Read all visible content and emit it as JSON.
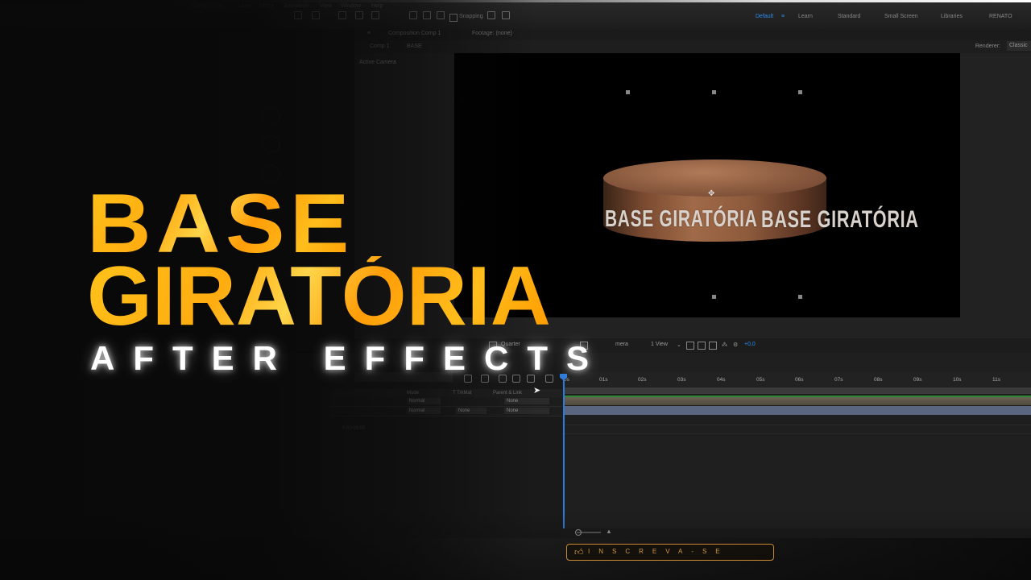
{
  "menu": {
    "items": [
      "Composition",
      "Layer",
      "Effect",
      "Animation",
      "View",
      "Window",
      "Help"
    ]
  },
  "toolbar": {
    "snapping_label": "Snapping"
  },
  "workspaces": {
    "active": "Default",
    "items": [
      "Learn",
      "Standard",
      "Small Screen",
      "Libraries",
      "RENATO"
    ]
  },
  "panels": {
    "composition_tab": "Composition Comp 1",
    "footage_tab": "Footage: (none)",
    "comp_subtabs": [
      "Comp 1",
      "BASE"
    ],
    "renderer_label": "Renderer:",
    "renderer_value": "Classic"
  },
  "viewer": {
    "camera_label": "Active Camera",
    "band_text": [
      "BASE GIRATÓRIA",
      "BASE GIRATÓRIA"
    ],
    "quality": "Quarter",
    "camera_select": "mera",
    "view_select": "1 View",
    "exposure": "+0,0"
  },
  "timeline": {
    "ticks": [
      "0s",
      "01s",
      "02s",
      "03s",
      "04s",
      "05s",
      "06s",
      "07s",
      "08s",
      "09s",
      "10s",
      "11s"
    ],
    "columns": [
      "Mode",
      "T TrkMat",
      "Parent & Link"
    ],
    "layers": [
      {
        "mode": "Normal",
        "trkmat": "",
        "parent": "None"
      },
      {
        "mode": "Normal",
        "trkmat": "None",
        "parent": "None"
      }
    ],
    "zoom_readout": "0:00:00:00"
  },
  "headline": {
    "line1": "BASE",
    "line2": "GIRATÓRIA",
    "subtitle": "AFTER EFFECTS"
  },
  "subscribe": {
    "icon": "thumbs-up-icon",
    "label": "INSCREVA-SE"
  },
  "colors": {
    "accent_blue": "#2d8ceb",
    "headline_orange": "#ffb21a",
    "subscribe_gold": "#d59a40"
  }
}
